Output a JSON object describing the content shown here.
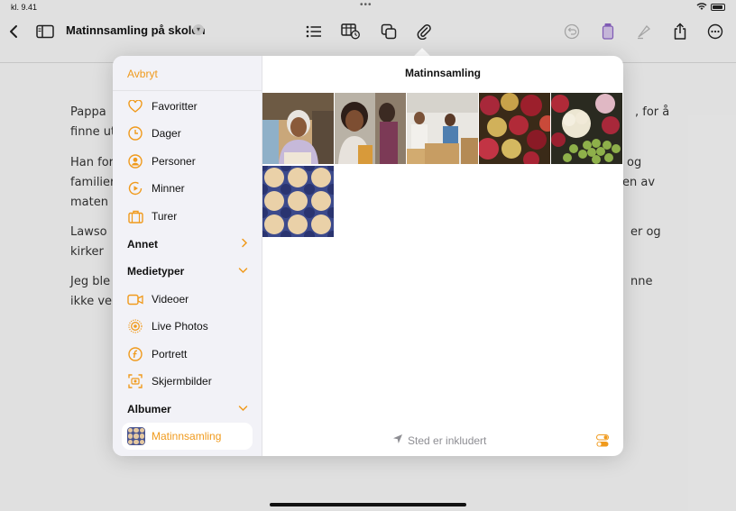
{
  "status": {
    "time": "kl. 9.41",
    "dots": "•••"
  },
  "toolbar": {
    "title": "Matinnsamling på skolen",
    "icons": [
      "back-chevron-icon",
      "sidebar-icon",
      "title-chevron-icon",
      "list-icon",
      "table-icon",
      "copy-icon",
      "paperclip-icon",
      "undo-icon",
      "format-icon",
      "pen-icon",
      "share-icon",
      "more-icon"
    ]
  },
  "document": {
    "lines": [
      "Pappa",
      "finne ut",
      "Han for",
      "familier",
      "maten",
      " Lawso",
      "kirker",
      "Jeg ble",
      "ikke ve"
    ],
    "right_fragments": [
      ", for å",
      "og",
      "en av",
      "er og",
      "nne"
    ]
  },
  "popover": {
    "cancel": "Avbryt",
    "title": "Matinnsamling",
    "sidebar_items": [
      {
        "label": "Favoritter",
        "icon": "heart-icon"
      },
      {
        "label": "Dager",
        "icon": "clock-icon"
      },
      {
        "label": "Personer",
        "icon": "person-icon"
      },
      {
        "label": "Minner",
        "icon": "memories-icon"
      },
      {
        "label": "Turer",
        "icon": "suitcase-icon"
      }
    ],
    "section_annet": "Annet",
    "section_medietyper": "Medietyper",
    "media_items": [
      {
        "label": "Videoer",
        "icon": "video-icon"
      },
      {
        "label": "Live Photos",
        "icon": "live-photo-icon"
      },
      {
        "label": "Portrett",
        "icon": "portrait-icon"
      },
      {
        "label": "Skjermbilder",
        "icon": "screenshot-icon"
      }
    ],
    "section_albumer": "Albumer",
    "album_selected": "Matinnsamling",
    "location": "Sted er inkludert",
    "photos": [
      "photo-woman-smiling",
      "photo-child-smiling",
      "photo-volunteers-boxes",
      "photo-apples",
      "photo-cauliflower-grapes",
      "photo-eggs"
    ]
  },
  "colors": {
    "accent": "#f09a1c"
  }
}
